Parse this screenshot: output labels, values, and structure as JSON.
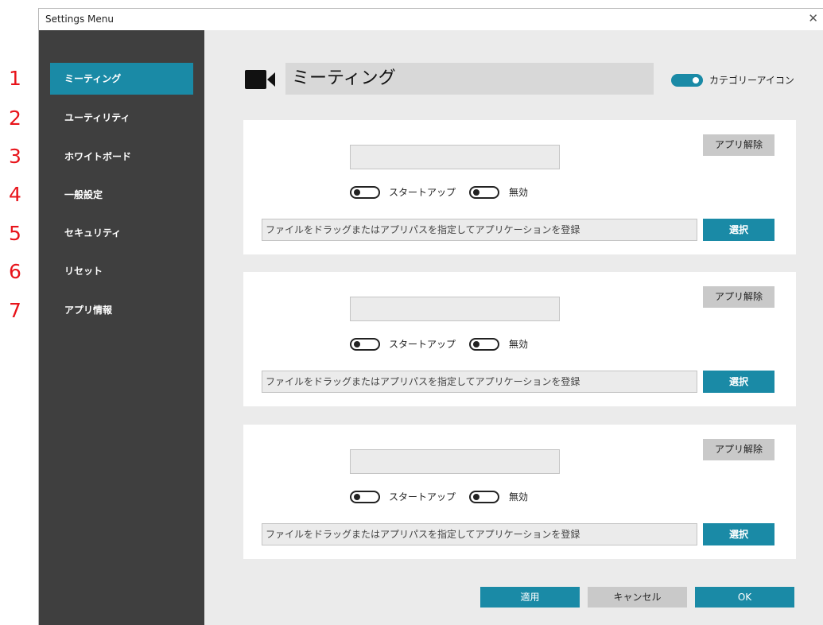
{
  "markers": [
    "1",
    "2",
    "3",
    "4",
    "5",
    "6",
    "7"
  ],
  "window": {
    "title": "Settings Menu",
    "close_glyph": "✕"
  },
  "sidebar": {
    "items": [
      {
        "label": "ミーティング",
        "active": true
      },
      {
        "label": "ユーティリティ",
        "active": false
      },
      {
        "label": "ホワイトボード",
        "active": false
      },
      {
        "label": "一般設定",
        "active": false
      },
      {
        "label": "セキュリティ",
        "active": false
      },
      {
        "label": "リセット",
        "active": false
      },
      {
        "label": "アプリ情報",
        "active": false
      }
    ]
  },
  "header": {
    "icon": "video-camera-icon",
    "title": "ミーティング",
    "category_toggle": {
      "label": "カテゴリーアイコン",
      "on": true
    }
  },
  "cards": [
    {
      "name_value": "",
      "remove_label": "アプリ解除",
      "startup_label": "スタートアップ",
      "startup_on": false,
      "disable_label": "無効",
      "disable_on": false,
      "path_placeholder": "ファイルをドラッグまたはアプリパスを指定してアプリケーションを登録",
      "select_label": "選択"
    },
    {
      "name_value": "",
      "remove_label": "アプリ解除",
      "startup_label": "スタートアップ",
      "startup_on": false,
      "disable_label": "無効",
      "disable_on": false,
      "path_placeholder": "ファイルをドラッグまたはアプリパスを指定してアプリケーションを登録",
      "select_label": "選択"
    },
    {
      "name_value": "",
      "remove_label": "アプリ解除",
      "startup_label": "スタートアップ",
      "startup_on": false,
      "disable_label": "無効",
      "disable_on": false,
      "path_placeholder": "ファイルをドラッグまたはアプリパスを指定してアプリケーションを登録",
      "select_label": "選択"
    }
  ],
  "footer": {
    "apply_label": "適用",
    "cancel_label": "キャンセル",
    "ok_label": "OK"
  },
  "colors": {
    "accent": "#1a8aa6",
    "sidebar_bg": "#3f3f3f",
    "marker": "#e8141b",
    "grey_button": "#c9c9c9"
  }
}
